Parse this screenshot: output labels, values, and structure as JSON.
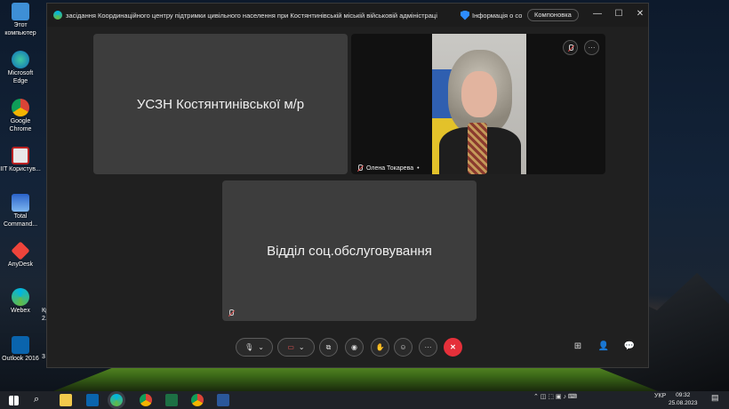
{
  "desktop": {
    "icons": [
      {
        "label": "Этот компьютер"
      },
      {
        "label": "Microsoft Edge"
      },
      {
        "label": "Google Chrome"
      },
      {
        "label": "IIT Користув..."
      },
      {
        "label": "Total Command..."
      },
      {
        "label": "AnyDesk"
      },
      {
        "label": "Webex"
      },
      {
        "label": "Outlook 2016"
      }
    ],
    "partial_labels": [
      "Кр",
      "2.",
      "3"
    ]
  },
  "window": {
    "title": "засідання Координаційного центру підтримки цивільного населення при Костянтинівській міській військовій адміністраці",
    "info_label": "Інформація о совещ...",
    "layout_label": "Компоновка",
    "minimize": "—",
    "maximize": "☐",
    "close": "✕"
  },
  "tiles": [
    {
      "name": "УСЗН Костянтинівської м/р"
    },
    {
      "name": "Відділ соц.обслуговування"
    }
  ],
  "video_tile": {
    "participant": "Олена Токарева",
    "more": "···"
  },
  "controls": {
    "more": "···",
    "end": "✕"
  },
  "taskbar": {
    "language": "УКР",
    "time": "09:32",
    "date": "25.08.2023"
  },
  "colors": {
    "end_call": "#e5303a",
    "accent": "#2d8cff",
    "tile_bg": "#3d3d3d"
  },
  "icons": [
    "windows-icon",
    "search-icon",
    "file-explorer-icon",
    "outlook-icon",
    "webex-icon",
    "chrome-icon",
    "excel-icon",
    "word-icon",
    "mic-icon",
    "camera-off-icon",
    "share-icon",
    "record-icon",
    "raise-hand-icon",
    "reactions-icon",
    "participants-icon",
    "chat-icon",
    "apps-icon"
  ]
}
